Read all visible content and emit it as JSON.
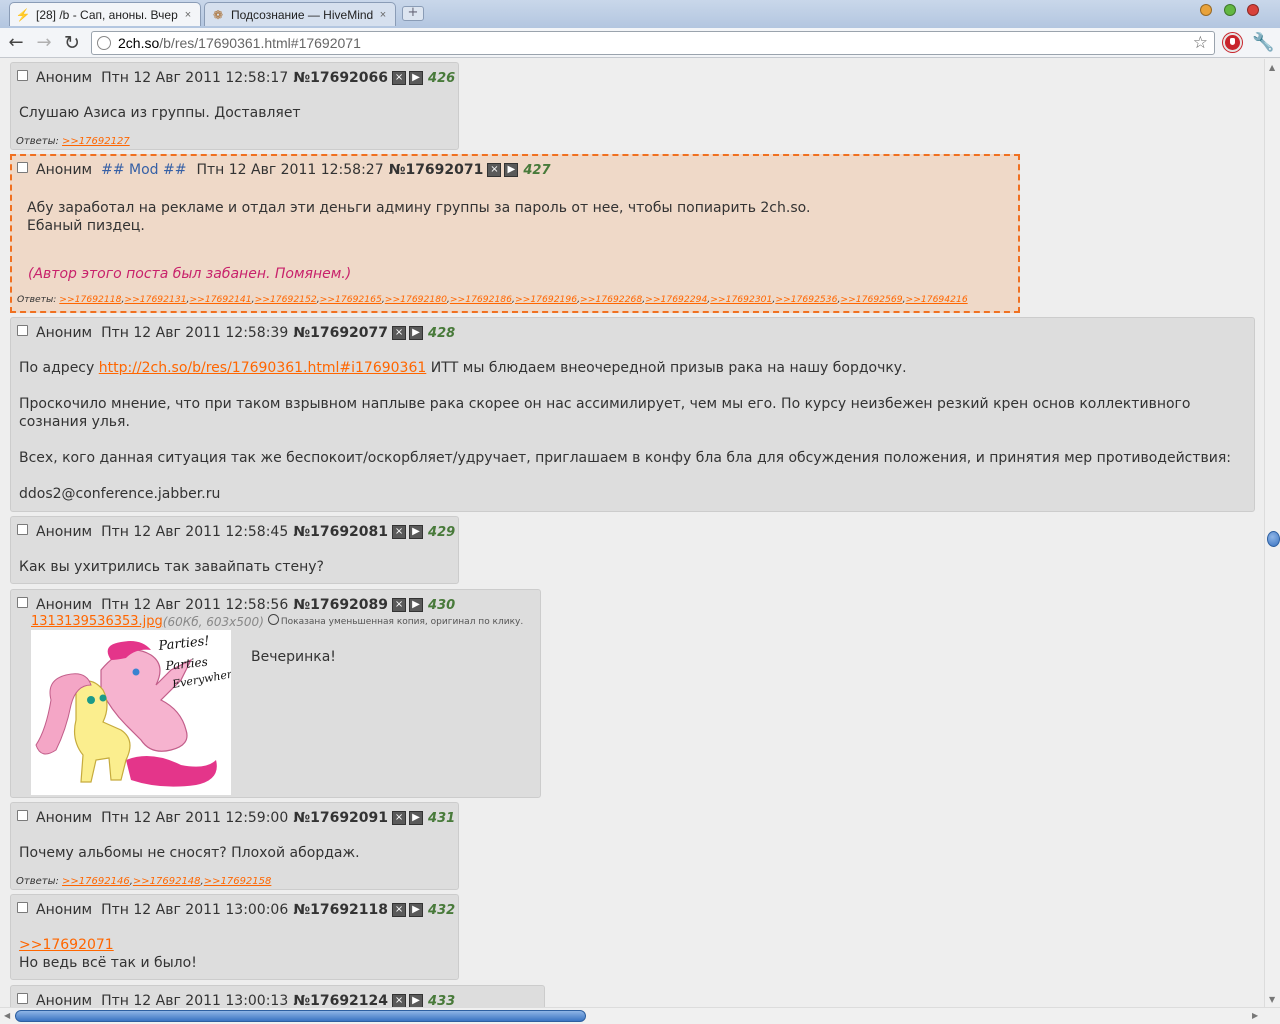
{
  "tabs": [
    {
      "title": "[28] /b - Сап, аноны. Вчер",
      "favicon": "lightning-icon",
      "active": true
    },
    {
      "title": "Подсознание — HiveMind",
      "favicon": "cookie-icon",
      "active": false
    }
  ],
  "tab_close": "×",
  "new_tab_label": "+",
  "address": {
    "host": "2ch.so",
    "path": "/b/res/17690361.html#17692071"
  },
  "nav": {
    "back": "←",
    "forward": "→",
    "reload": "↻",
    "star": "☆",
    "wrench": "🔧"
  },
  "post_ui": {
    "hide_btn": "×",
    "reply_btn": "▶",
    "replies_label": "Ответы:"
  },
  "posts": [
    {
      "author": "Аноним",
      "date": "Птн 12 Авг 2011 12:58:17",
      "number": "№17692066",
      "counter": "426",
      "lines": [
        "Слушаю Азиса из группы. Доставляет"
      ],
      "replies": [
        ">>17692127"
      ]
    },
    {
      "author": "Аноним",
      "mod_tag": "## Mod ##",
      "date": "Птн 12 Авг 2011 12:58:27",
      "number": "№17692071",
      "counter": "427",
      "lines": [
        "Абу заработал на рекламе и отдал эти деньги админу группы за пароль от нее, чтобы попиарить 2ch.so.",
        "Ебаный пиздец."
      ],
      "ban_note": "(Автор этого поста был забанен. Помянем.)",
      "replies": [
        ">>17692118",
        ">>17692131",
        ">>17692141",
        ">>17692152",
        ">>17692165",
        ">>17692180",
        ">>17692186",
        ">>17692196",
        ">>17692268",
        ">>17692294",
        ">>17692301",
        ">>17692536",
        ">>17692569",
        ">>17694216"
      ]
    },
    {
      "author": "Аноним",
      "date": "Птн 12 Авг 2011 12:58:39",
      "number": "№17692077",
      "counter": "428",
      "line1_pre": "По адресу ",
      "line1_link": "http://2ch.so/b/res/17690361.html#i17690361",
      "line1_post": " ИТТ мы блюдаем внеочередной призыв рака на нашу бордочку.",
      "line2": "Проскочило мнение, что при таком взрывном наплыве рака скорее он нас ассимилирует, чем мы его. По курсу неизбежен резкий крен основ коллективного",
      "line3": "сознания улья.",
      "line4": "Всех, кого данная ситуация так же беспокоит/оскорбляет/удручает, приглашаем в конфу бла бла для обсуждения положения, и принятия мер противодействия:",
      "line5": "ddos2@conference.jabber.ru"
    },
    {
      "author": "Аноним",
      "date": "Птн 12 Авг 2011 12:58:45",
      "number": "№17692081",
      "counter": "429",
      "lines": [
        "Как вы ухитрились так завайпать стену?"
      ]
    },
    {
      "author": "Аноним",
      "date": "Птн 12 Авг 2011 12:58:56",
      "number": "№17692089",
      "counter": "430",
      "file_name": "1313139536353.jpg",
      "file_meta": "(60Кб, 603x500)",
      "thumb_note": "Показана уменьшенная копия, оригинал по клику.",
      "thumb_text": [
        "Parties!",
        "Parties",
        "Everywhere"
      ],
      "lines": [
        "Вечеринка!"
      ]
    },
    {
      "author": "Аноним",
      "date": "Птн 12 Авг 2011 12:59:00",
      "number": "№17692091",
      "counter": "431",
      "lines": [
        "Почему альбомы не сносят? Плохой абордаж."
      ],
      "replies": [
        ">>17692146",
        ">>17692148",
        ">>17692158"
      ]
    },
    {
      "author": "Аноним",
      "date": "Птн 12 Авг 2011 13:00:06",
      "number": "№17692118",
      "counter": "432",
      "quote": ">>17692071",
      "lines": [
        "Но ведь всё так и было!"
      ]
    },
    {
      "author": "Аноним",
      "date": "Птн 12 Авг 2011 13:00:13",
      "number": "№17692124",
      "counter": "433"
    }
  ],
  "colors": {
    "accent_link": "#ff6600",
    "counter": "#487a3a",
    "mod_border": "#f07020",
    "ban_note": "#c8226b",
    "mod_tag": "#3660a6"
  }
}
